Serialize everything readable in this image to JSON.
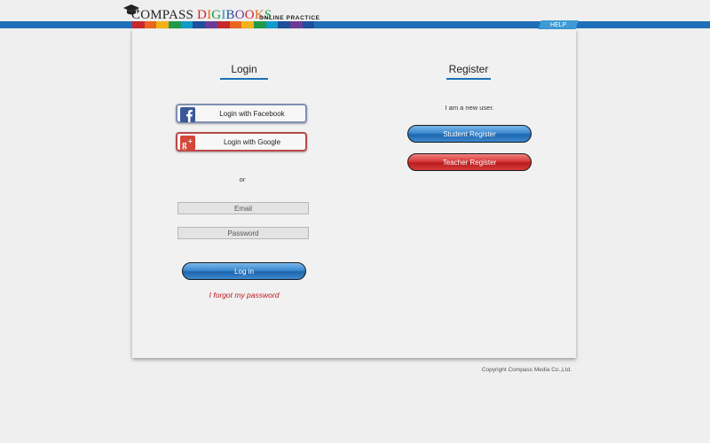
{
  "header": {
    "brand_main": "COMPASS",
    "brand_digi": "DIGIBOOKS",
    "brand_sub": "ONLINE PRACTICE",
    "help_label": "HELP",
    "strip_colors": [
      "#c8282d",
      "#e8671f",
      "#f2b318",
      "#1e9a4a",
      "#129bc8",
      "#1f4f9c",
      "#6b3c96",
      "#c8282d",
      "#e8671f",
      "#f2b318",
      "#1e9a4a",
      "#129bc8",
      "#1f4f9c",
      "#6b3c96",
      "#1f4f9c"
    ]
  },
  "login": {
    "title": "Login",
    "facebook_label": "Login with Facebook",
    "google_label": "Login with Google",
    "or_text": "or",
    "email_placeholder": "Email",
    "password_placeholder": "Password",
    "login_button": "Log in",
    "forgot_link": "I forgot my password"
  },
  "register": {
    "title": "Register",
    "new_user_text": "I am a new user.",
    "student_button": "Student Register",
    "teacher_button": "Teacher Register"
  },
  "footer": {
    "copyright": "Copyright Compass Media Co.,Ltd."
  },
  "colors": {
    "accent_blue": "#1f6fb8",
    "help_blue": "#3e9bd6",
    "forgot_red": "#c0141e"
  },
  "icons": {
    "facebook": "facebook-icon",
    "google": "google-plus-icon",
    "cap": "graduation-cap-icon"
  }
}
